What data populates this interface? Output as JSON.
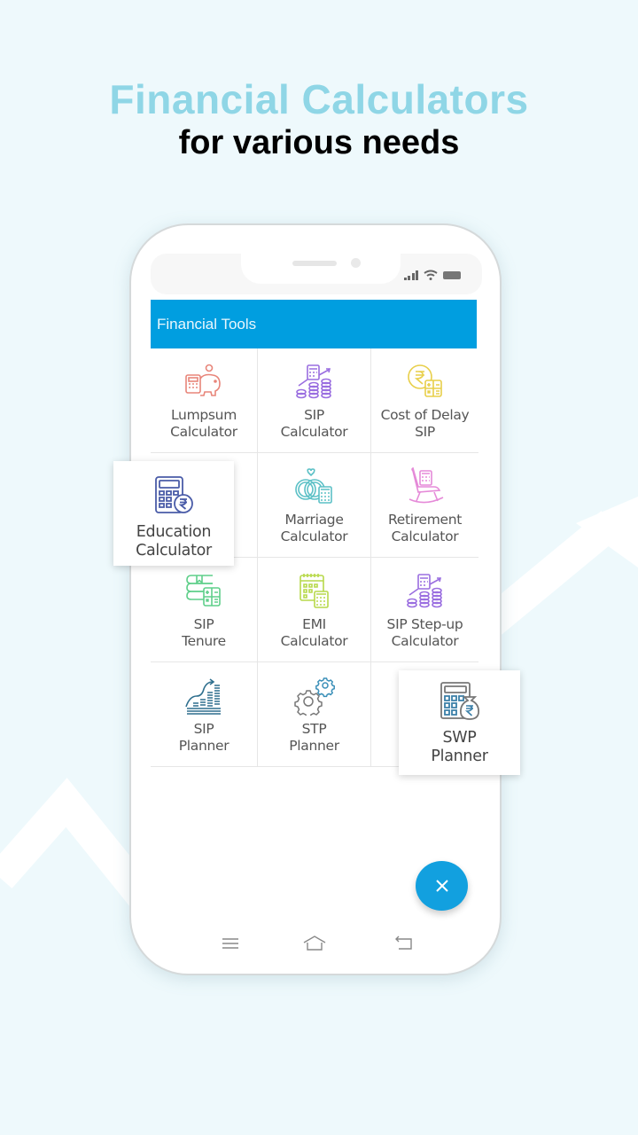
{
  "headline": {
    "title": "Financial Calculators",
    "subtitle": "for various needs"
  },
  "colors": {
    "title": "#8fd6e6",
    "appbar": "#009ee0",
    "fab": "#12a0df",
    "background": "#eef9fc"
  },
  "appbar": {
    "title": "Financial Tools"
  },
  "tools": [
    {
      "line1": "Lumpsum",
      "line2": "Calculator",
      "icon": "piggy-bank-calculator-icon",
      "color": "#e8857a"
    },
    {
      "line1": "SIP",
      "line2": "Calculator",
      "icon": "calculator-coins-growth-icon",
      "color": "#9a6ee0"
    },
    {
      "line1": "Cost of Delay",
      "line2": "SIP",
      "icon": "rupee-coin-calculator-icon",
      "color": "#e8cf4a"
    },
    {
      "line1": "Education",
      "line2": "Calculator",
      "icon": "calculator-rupee-icon",
      "color": "#4a5ca8"
    },
    {
      "line1": "Marriage",
      "line2": "Calculator",
      "icon": "rings-calculator-icon",
      "color": "#5bc0c6"
    },
    {
      "line1": "Retirement",
      "line2": "Calculator",
      "icon": "rocking-chair-calculator-icon",
      "color": "#e58ad8"
    },
    {
      "line1": "SIP",
      "line2": "Tenure",
      "icon": "books-calculator-icon",
      "color": "#5fcf8a"
    },
    {
      "line1": "EMI",
      "line2": "Calculator",
      "icon": "calendar-calculator-icon",
      "color": "#b7d94a"
    },
    {
      "line1": "SIP Step-up",
      "line2": "Calculator",
      "icon": "calculator-coins-stepup-icon",
      "color": "#9a6ee0"
    },
    {
      "line1": "SIP",
      "line2": "Planner",
      "icon": "growth-bars-icon",
      "color": "#2f6f8e"
    },
    {
      "line1": "STP",
      "line2": "Planner",
      "icon": "gears-icon",
      "color": "#777777"
    },
    {
      "line1": "SWP",
      "line2": "Planner",
      "icon": "calculator-money-bag-icon",
      "color": "#3a7fa8"
    }
  ],
  "navbar": {
    "recent": "recent-apps-icon",
    "home": "home-icon",
    "back": "back-icon"
  },
  "fab": {
    "icon": "close-icon"
  }
}
